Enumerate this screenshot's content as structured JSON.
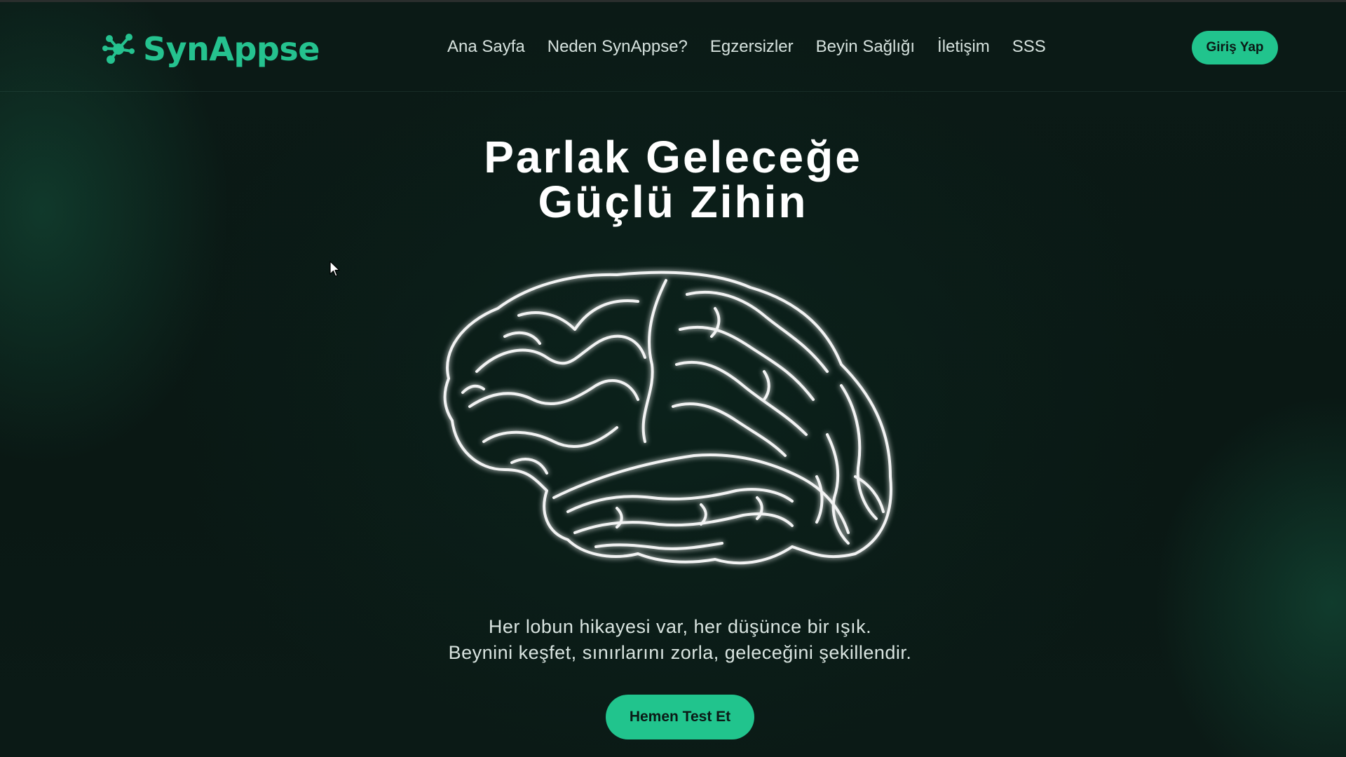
{
  "brand": {
    "name": "SynAppse",
    "accent_color": "#21c48d",
    "logo_icon": "molecule-icon"
  },
  "nav": {
    "items": [
      {
        "label": "Ana Sayfa"
      },
      {
        "label": "Neden SynAppse?"
      },
      {
        "label": "Egzersizler"
      },
      {
        "label": "Beyin Sağlığı"
      },
      {
        "label": "İletişim"
      },
      {
        "label": "SSS"
      }
    ],
    "login_label": "Giriş Yap"
  },
  "hero": {
    "title_line1": "Parlak Geleceğe",
    "title_line2": "Güçlü Zihin",
    "illustration": "brain-icon",
    "tagline_line1": "Her lobun hikayesi var, her düşünce bir ışık.",
    "tagline_line2": "Beynini keşfet, sınırlarını zorla, geleceğini şekillendir.",
    "cta_label": "Hemen Test Et"
  }
}
